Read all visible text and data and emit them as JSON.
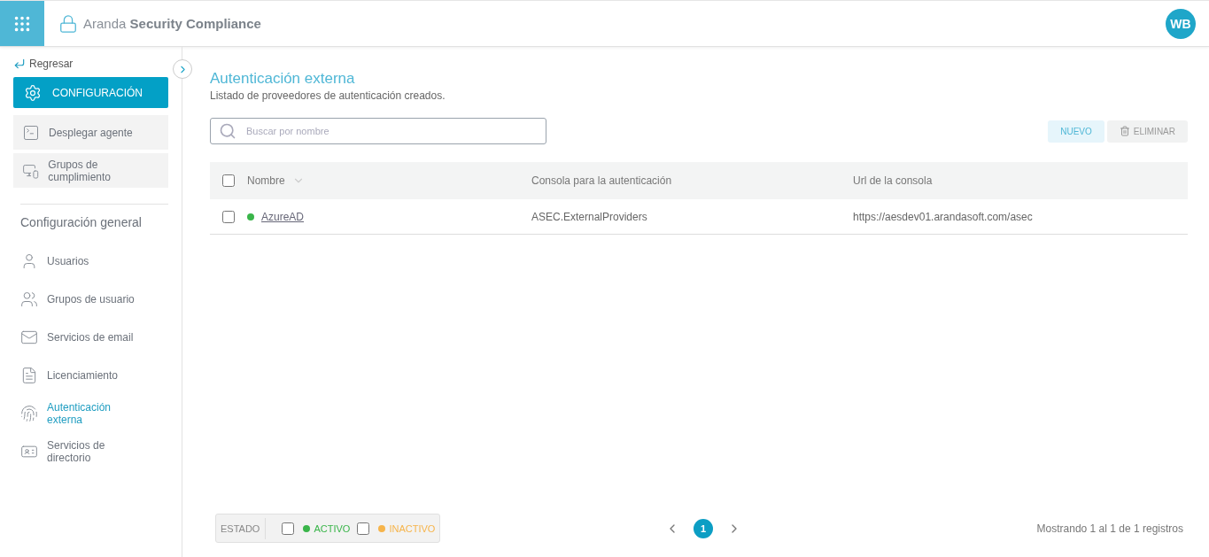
{
  "header": {
    "brand_light": "Aranda",
    "brand_bold": "Security Compliance",
    "avatar": "WB"
  },
  "sidebar": {
    "back": "Regresar",
    "section": {
      "label": "CONFIGURACIÓN",
      "selected": true
    },
    "tools": [
      {
        "label": "Desplegar agente"
      },
      {
        "label": "Grupos de cumplimiento"
      }
    ],
    "group_title": "Configuración general",
    "items": [
      {
        "label": "Usuarios",
        "selected": false
      },
      {
        "label": "Grupos de usuario",
        "selected": false
      },
      {
        "label": "Servicios de email",
        "selected": false
      },
      {
        "label": "Licenciamiento",
        "selected": false
      },
      {
        "label": "Autenticación externa",
        "selected": true
      },
      {
        "label": "Servicios de directorio",
        "selected": false
      }
    ]
  },
  "page": {
    "title": "Autenticación externa",
    "subtitle": "Listado de proveedores de autenticación creados."
  },
  "search": {
    "placeholder": "Buscar por nombre"
  },
  "actions": [
    {
      "label": "NUEVO",
      "disabled": false
    },
    {
      "label": "ELIMINAR",
      "disabled": true
    }
  ],
  "table": {
    "columns": [
      "Nombre",
      "Consola para la autenticación",
      "Url de la consola"
    ],
    "all_checked": false,
    "rows": [
      {
        "checked": false,
        "color": "#3ab54a",
        "name": "AzureAD",
        "console": "ASEC.ExternalProviders",
        "url": "https://aesdev01.arandasoft.com/asec"
      }
    ]
  },
  "filter": {
    "label": "ESTADO",
    "options": [
      {
        "label": "ACTIVO",
        "checked": false,
        "color": "#3ab54a"
      },
      {
        "label": "INACTIVO",
        "checked": false,
        "color": "#f6b44b"
      }
    ]
  },
  "pagination": {
    "pages": [
      {
        "label": "1",
        "selected": true
      }
    ]
  },
  "summary": "Mostrando 1 al 1 de 1 registros"
}
